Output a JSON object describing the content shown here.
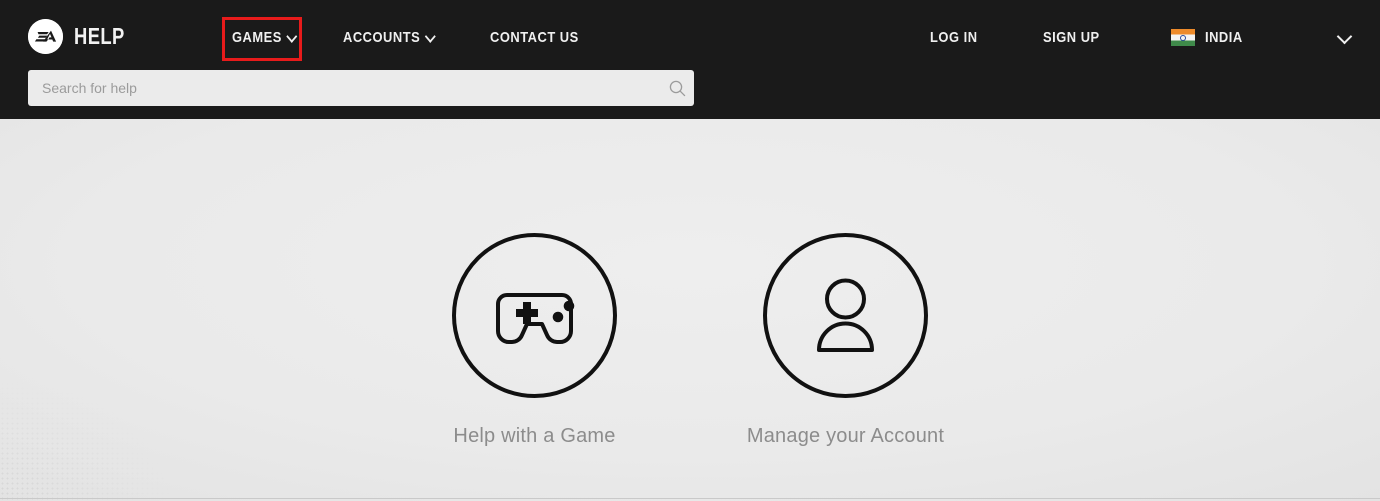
{
  "header": {
    "brand": {
      "logo_icon": "ea-logo-icon",
      "title": "HELP"
    },
    "nav": [
      {
        "id": "games",
        "label": "GAMES",
        "has_dropdown": true,
        "highlighted": true
      },
      {
        "id": "accounts",
        "label": "ACCOUNTS",
        "has_dropdown": true,
        "highlighted": false
      },
      {
        "id": "contact-us",
        "label": "CONTACT US",
        "has_dropdown": false,
        "highlighted": false
      }
    ],
    "account_actions": [
      {
        "id": "log-in",
        "label": "LOG IN"
      },
      {
        "id": "sign-up",
        "label": "SIGN UP"
      }
    ],
    "region": {
      "label": "INDIA",
      "flag_icon": "india-flag-icon"
    },
    "language_chevron_icon": "chevron-down-icon",
    "background_color": "#1a1a1a",
    "text_color": "#f0f0f0"
  },
  "search": {
    "placeholder": "Search for help",
    "value": "",
    "icon": "search-icon",
    "background_color": "#ebebeb"
  },
  "annotation": {
    "target": "games",
    "color": "#e81b1b",
    "shape": "rectangle-outline"
  },
  "main": {
    "tiles": [
      {
        "id": "help-with-a-game",
        "label": "Help with a Game",
        "icon": "gamepad-icon"
      },
      {
        "id": "manage-your-account",
        "label": "Manage your Account",
        "icon": "person-icon"
      }
    ],
    "label_color": "#8c8c8c"
  }
}
